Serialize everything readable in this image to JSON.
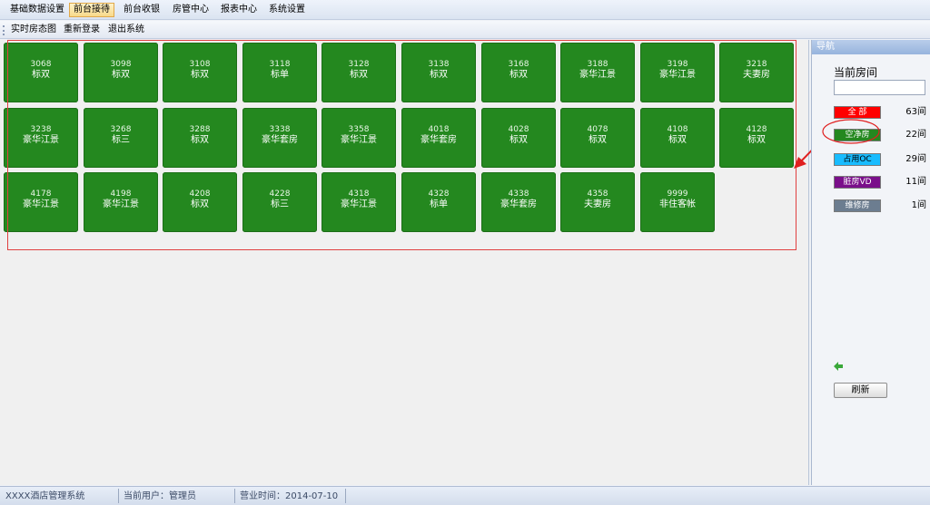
{
  "menu": [
    {
      "label": "基础数据设置",
      "active": false
    },
    {
      "label": "前台接待",
      "active": true
    },
    {
      "label": "前台收银",
      "active": false
    },
    {
      "label": "房管中心",
      "active": false
    },
    {
      "label": "报表中心",
      "active": false
    },
    {
      "label": "系统设置",
      "active": false
    }
  ],
  "toolbar": [
    "实时房态图",
    "重新登录",
    "退出系统"
  ],
  "room_color": "#24881f",
  "rooms": [
    [
      {
        "num": "3068",
        "type": "标双"
      },
      {
        "num": "3098",
        "type": "标双"
      },
      {
        "num": "3108",
        "type": "标双"
      },
      {
        "num": "3118",
        "type": "标单"
      },
      {
        "num": "3128",
        "type": "标双"
      },
      {
        "num": "3138",
        "type": "标双"
      },
      {
        "num": "3168",
        "type": "标双"
      },
      {
        "num": "3188",
        "type": "豪华江景"
      },
      {
        "num": "3198",
        "type": "豪华江景"
      },
      {
        "num": "3218",
        "type": "夫妻房"
      }
    ],
    [
      {
        "num": "3238",
        "type": "豪华江景"
      },
      {
        "num": "3268",
        "type": "标三"
      },
      {
        "num": "3288",
        "type": "标双"
      },
      {
        "num": "3338",
        "type": "豪华套房"
      },
      {
        "num": "3358",
        "type": "豪华江景"
      },
      {
        "num": "4018",
        "type": "豪华套房"
      },
      {
        "num": "4028",
        "type": "标双"
      },
      {
        "num": "4078",
        "type": "标双"
      },
      {
        "num": "4108",
        "type": "标双"
      },
      {
        "num": "4128",
        "type": "标双"
      }
    ],
    [
      {
        "num": "4178",
        "type": "豪华江景"
      },
      {
        "num": "4198",
        "type": "豪华江景"
      },
      {
        "num": "4208",
        "type": "标双"
      },
      {
        "num": "4228",
        "type": "标三"
      },
      {
        "num": "4318",
        "type": "豪华江景"
      },
      {
        "num": "4328",
        "type": "标单"
      },
      {
        "num": "4338",
        "type": "豪华套房"
      },
      {
        "num": "4358",
        "type": "夫妻房"
      },
      {
        "num": "9999",
        "type": "非住客帐"
      }
    ]
  ],
  "nav": {
    "title": "导航",
    "current_room_label": "当前房间",
    "current_room_value": "",
    "statuses": [
      {
        "label": "全  部",
        "count": "63间",
        "bg": "#ff0000",
        "fg": "#ffffff"
      },
      {
        "label": "空净房",
        "count": "22间",
        "bg": "#24881f",
        "fg": "#ffffff"
      },
      {
        "label": "占用OC",
        "count": "29间",
        "bg": "#19bcff",
        "fg": "#000000"
      },
      {
        "label": "脏房VD",
        "count": "11间",
        "bg": "#7a0f8a",
        "fg": "#ffffff"
      },
      {
        "label": "维修房",
        "count": "1间",
        "bg": "#6c7d90",
        "fg": "#ffffff"
      }
    ],
    "refresh_label": "刷新"
  },
  "statusbar": {
    "system": "XXXX酒店管理系统",
    "user": "当前用户：管理员",
    "date": "营业时间：2014-07-10"
  }
}
